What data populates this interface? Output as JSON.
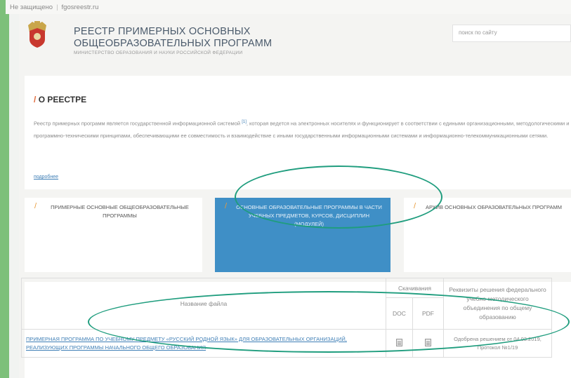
{
  "browser": {
    "security": "Не защищено",
    "url": "fgosreestr.ru"
  },
  "header": {
    "title_line1": "РЕЕСТР ПРИМЕРНЫХ ОСНОВНЫХ",
    "title_line2": "ОБЩЕОБРАЗОВАТЕЛЬНЫХ ПРОГРАММ",
    "subtitle": "МИНИСТЕРСТВО ОБРАЗОВАНИЯ И НАУКИ РОССИЙСКОЙ ФЕДЕРАЦИИ",
    "search_placeholder": "поиск по сайту"
  },
  "about": {
    "slash": "/",
    "heading": "О РЕЕСТРЕ",
    "text_a": "Реестр примерных программ является государственной информационной системой",
    "footnote": "[1]",
    "text_b": ", которая ведется на электронных носителях и функционирует в соответствии с едиными организационными, методологическими и программно-техническими принципами, обеспечивающими ее совместимость и взаимодействие с иными государственными информационными системами и информационно-телекоммуникационными сетями.",
    "more_link": "подробнее"
  },
  "tiles": [
    {
      "slash": "/",
      "label": "ПРИМЕРНЫЕ ОСНОВНЫЕ ОБЩЕОБРАЗОВАТЕЛЬНЫЕ ПРОГРАММЫ"
    },
    {
      "slash": "/",
      "label": "ОСНОВНЫЕ ОБРАЗОВАТЕЛЬНЫЕ ПРОГРАММЫ В ЧАСТИ УЧЕБНЫХ ПРЕДМЕТОВ, КУРСОВ, ДИСЦИПЛИН (МОДУЛЕЙ)"
    },
    {
      "slash": "/",
      "label": "АРХИВ ОСНОВНЫХ ОБРАЗОВАТЕЛЬНЫХ ПРОГРАММ"
    }
  ],
  "table": {
    "col_name": "Название файла",
    "col_downloads": "Скачивания",
    "col_doc": "DOC",
    "col_pdf": "PDF",
    "col_details": "Реквизиты решения федерального учебно-методического объединения по общему образованию",
    "rows": [
      {
        "name": "ПРИМЕРНАЯ ПРОГРАММА ПО УЧЕБНОМУ ПРЕДМЕТУ «РУССКИЙ РОДНОЙ ЯЗЫК» ДЛЯ ОБРАЗОВАТЕЛЬНЫХ ОРГАНИЗАЦИЙ, РЕАЛИЗУЮЩИХ ПРОГРАММЫ НАЧАЛЬНОГО ОБЩЕГО ОБРАЗОВАНИЯ",
        "details": "Одобрена решением от 04.03.2019, Протокол №1/19"
      }
    ]
  },
  "colors": {
    "accent": "#3f8fc6",
    "annotation": "#1f9d7e",
    "slash": "#e06a3a",
    "sidebar": "#7dc07a"
  }
}
